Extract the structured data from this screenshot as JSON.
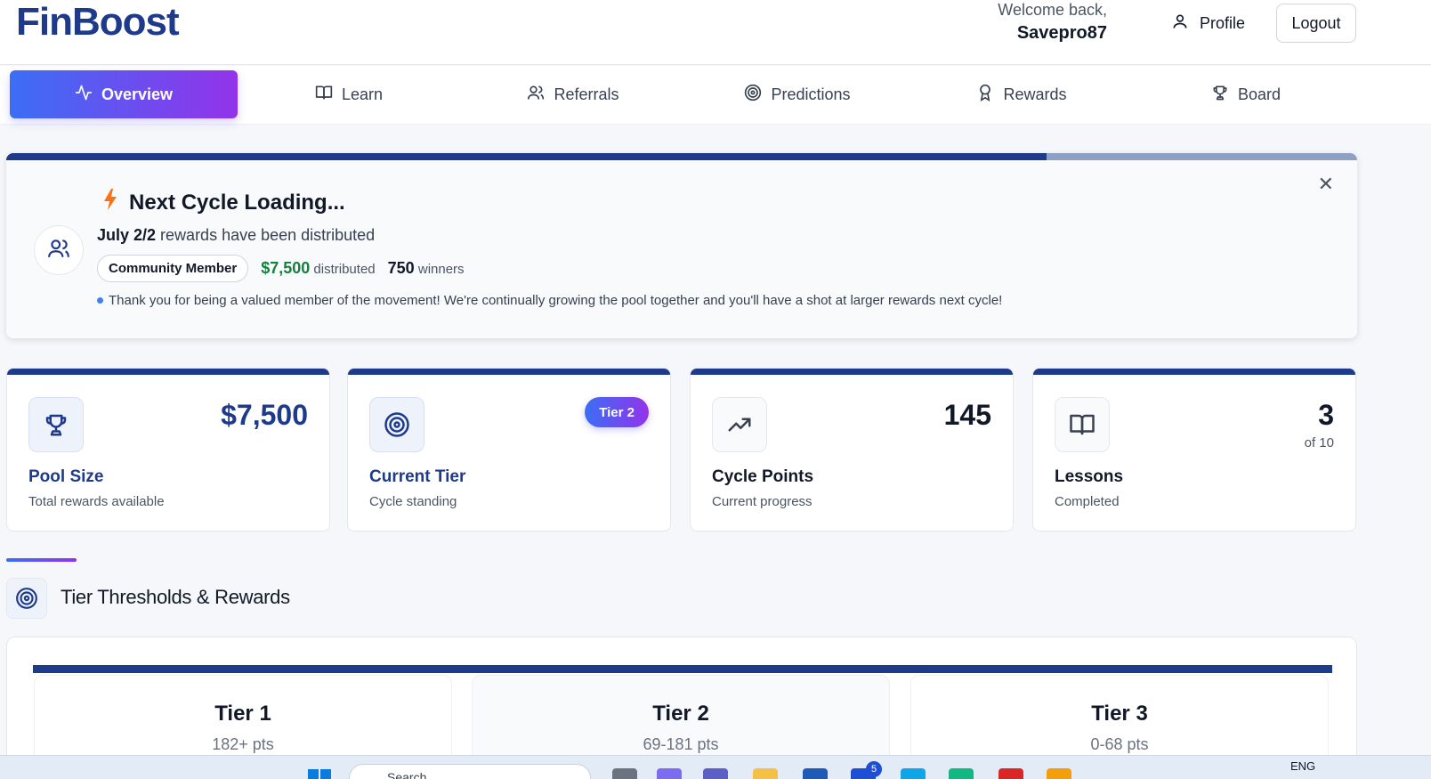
{
  "header": {
    "logo": "FinBoost",
    "welcome": "Welcome back,",
    "username": "Savepro87",
    "profile_label": "Profile",
    "logout_label": "Logout"
  },
  "nav": {
    "tabs": [
      {
        "label": "Overview",
        "icon": "activity-icon",
        "active": true
      },
      {
        "label": "Learn",
        "icon": "book-icon",
        "active": false
      },
      {
        "label": "Referrals",
        "icon": "users-icon",
        "active": false
      },
      {
        "label": "Predictions",
        "icon": "target-icon",
        "active": false
      },
      {
        "label": "Rewards",
        "icon": "award-icon",
        "active": false
      },
      {
        "label": "Board",
        "icon": "trophy-icon",
        "active": false
      }
    ]
  },
  "banner": {
    "title": "Next Cycle Loading...",
    "line_bold": "July 2/2",
    "line_rest": " rewards have been distributed",
    "chip": "Community Member",
    "amount": "$7,500",
    "amount_suffix": "distributed",
    "winners_count": "750",
    "winners_suffix": "winners",
    "note": "Thank you for being a valued member of the movement! We're continually growing the pool together and you'll have a shot at larger rewards next cycle!",
    "progress": 0.77
  },
  "cards": {
    "pool": {
      "title": "Pool Size",
      "sub": "Total rewards available",
      "value": "$7,500"
    },
    "tier": {
      "title": "Current Tier",
      "sub": "Cycle standing",
      "badge": "Tier 2"
    },
    "points": {
      "title": "Cycle Points",
      "sub": "Current progress",
      "value": "145"
    },
    "lessons": {
      "title": "Lessons",
      "sub": "Completed",
      "value": "3",
      "value_sub": "of 10"
    }
  },
  "tiers_section": {
    "title": "Tier Thresholds & Rewards",
    "tiers": [
      {
        "name": "Tier 1",
        "pts": "182+ pts"
      },
      {
        "name": "Tier 2",
        "pts": "69-181 pts"
      },
      {
        "name": "Tier 3",
        "pts": "0-68 pts"
      }
    ]
  },
  "taskbar": {
    "search_placeholder": "Search",
    "mail_badge": "5",
    "lang": "ENG"
  },
  "colors": {
    "brand_navy": "#1e3a8a",
    "gradient_start": "#3b6ef5",
    "gradient_end": "#9333ea",
    "amount_green": "#15803d"
  }
}
